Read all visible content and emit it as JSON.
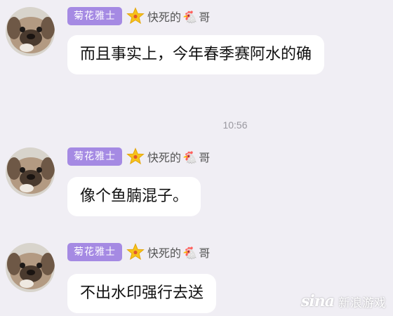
{
  "chat": {
    "timestamp": "10:56",
    "messages": [
      {
        "sender_badge": "菊花雅士",
        "sender_name_prefix": "快死的",
        "sender_name_emoji": "🐔",
        "sender_name_suffix": "哥",
        "text": "而且事实上，今年春季赛阿水的确"
      },
      {
        "sender_badge": "菊花雅士",
        "sender_name_prefix": "快死的",
        "sender_name_emoji": "🐔",
        "sender_name_suffix": "哥",
        "text": "像个鱼腩混子。"
      },
      {
        "sender_badge": "菊花雅士",
        "sender_name_prefix": "快死的",
        "sender_name_emoji": "🐔",
        "sender_name_suffix": "哥",
        "text": "不出水印强行去送"
      }
    ]
  },
  "watermark": {
    "logo": "sina",
    "text": "新浪游戏"
  },
  "icons": {
    "avatar": "dog-avatar-icon",
    "badge_icon": "star-icon"
  },
  "colors": {
    "background": "#f0eef4",
    "badge": "#a58ae3",
    "bubble": "#ffffff",
    "star": "#f7c31a"
  }
}
